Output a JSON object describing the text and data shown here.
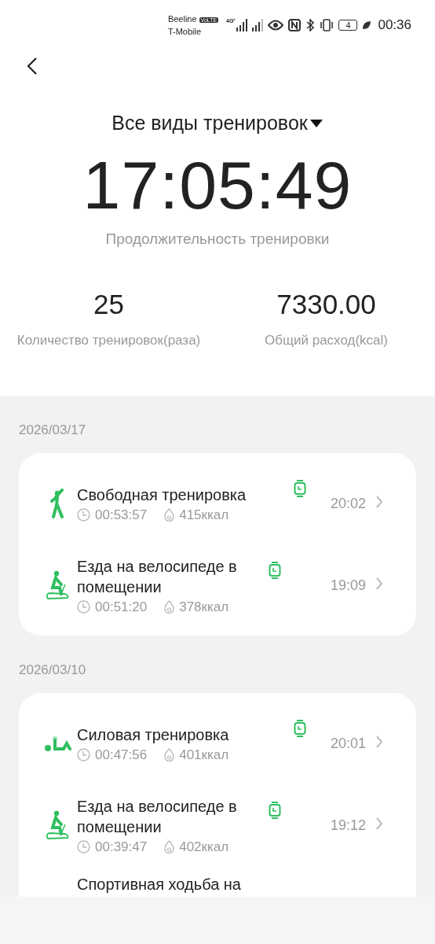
{
  "status_bar": {
    "carriers": [
      "Beeline",
      "T-Mobile"
    ],
    "volte": "VoLTE",
    "network": "4G⁺",
    "battery": "4",
    "time": "00:36"
  },
  "header": {
    "filter": "Все виды тренировок"
  },
  "summary": {
    "duration": "17:05:49",
    "duration_label": "Продолжительность тренировки",
    "stats": [
      {
        "value": "25",
        "label": "Количество тренировок(раза)"
      },
      {
        "value": "7330.00",
        "label": "Общий расход(kcal)"
      }
    ]
  },
  "days": [
    {
      "date": "2026/03/17",
      "workouts": [
        {
          "kind": "free",
          "name": "Свободная тренировка",
          "duration": "00:53:57",
          "calories": "415ккал",
          "time": "20:02"
        },
        {
          "kind": "bike",
          "name": "Езда на велосипеде в помещении",
          "duration": "00:51:20",
          "calories": "378ккал",
          "time": "19:09"
        }
      ]
    },
    {
      "date": "2026/03/10",
      "workouts": [
        {
          "kind": "strength",
          "name": "Силовая тренировка",
          "duration": "00:47:56",
          "calories": "401ккал",
          "time": "20:01"
        },
        {
          "kind": "bike",
          "name": "Езда на велосипеде в помещении",
          "duration": "00:39:47",
          "calories": "402ккал",
          "time": "19:12"
        },
        {
          "kind": "walk",
          "name": "Спортивная ходьба на",
          "partial": true
        }
      ]
    }
  ]
}
